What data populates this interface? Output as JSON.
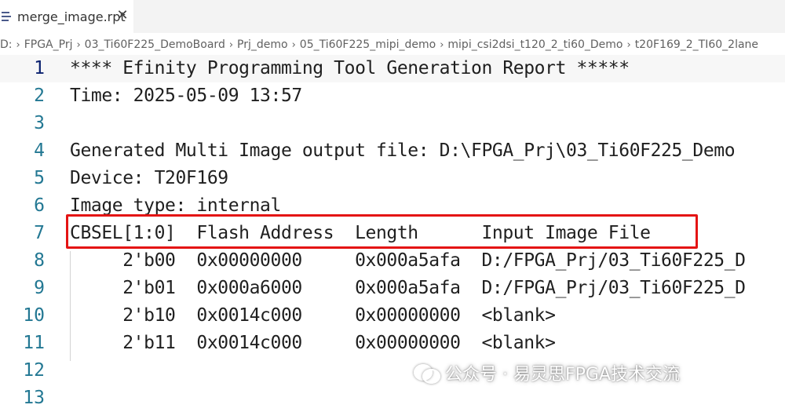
{
  "tab": {
    "filename": "merge_image.rpt",
    "close_glyph": "✕"
  },
  "breadcrumb": [
    "D:",
    "FPGA_Prj",
    "03_Ti60F225_DemoBoard",
    "Prj_demo",
    "05_Ti60F225_mipi_demo",
    "mipi_csi2dsi_t120_2_ti60_Demo",
    "t20F169_2_TI60_2lane"
  ],
  "lines": [
    {
      "num": "1",
      "text": "**** Efinity Programming Tool Generation Report *****"
    },
    {
      "num": "2",
      "text": "Time: 2025-05-09 13:57"
    },
    {
      "num": "3",
      "text": ""
    },
    {
      "num": "4",
      "text": "Generated Multi Image output file: D:\\FPGA_Prj\\03_Ti60F225_Demo"
    },
    {
      "num": "5",
      "text": "Device: T20F169"
    },
    {
      "num": "6",
      "text": "Image type: internal"
    },
    {
      "num": "7",
      "text": "CBSEL[1:0]  Flash Address  Length      Input Image File"
    },
    {
      "num": "8",
      "text": "     2'b00  0x00000000     0x000a5afa  D:/FPGA_Prj/03_Ti60F225_D"
    },
    {
      "num": "9",
      "text": "     2'b01  0x000a6000     0x000a5afa  D:/FPGA_Prj/03_Ti60F225_D"
    },
    {
      "num": "10",
      "text": "     2'b10  0x0014c000     0x00000000  <blank>"
    },
    {
      "num": "11",
      "text": "     2'b11  0x0014c000     0x00000000  <blank>"
    },
    {
      "num": "12",
      "text": ""
    },
    {
      "num": "13",
      "text": ""
    }
  ],
  "current_line": "1",
  "watermark": {
    "text": "公众号 · 易灵思FPGA技术交流",
    "icon": "wechat-icon"
  },
  "colors": {
    "line_number": "#237893",
    "highlight_box": "#e41414",
    "tab_bar": "#f3f3f3"
  }
}
